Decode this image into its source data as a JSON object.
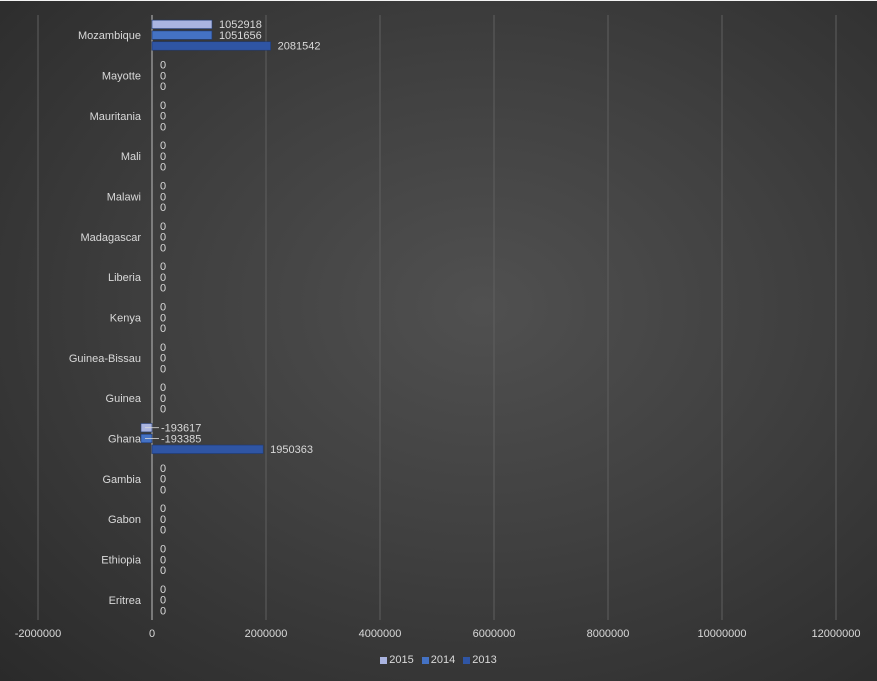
{
  "chart_data": {
    "type": "bar",
    "orientation": "horizontal",
    "title": "",
    "xlabel": "",
    "ylabel": "",
    "xlim": [
      -2000000,
      12000000
    ],
    "x_ticks": [
      -2000000,
      0,
      2000000,
      4000000,
      6000000,
      8000000,
      10000000,
      12000000
    ],
    "x_tick_labels": [
      "-2000000",
      "0",
      "2000000",
      "4000000",
      "6000000",
      "8000000",
      "10000000",
      "12000000"
    ],
    "grid": true,
    "legend_position": "bottom",
    "categories": [
      "Mozambique",
      "Mayotte",
      "Mauritania",
      "Mali",
      "Malawi",
      "Madagascar",
      "Liberia",
      "Kenya",
      "Guinea-Bissau",
      "Guinea",
      "Ghana",
      "Gambia",
      "Gabon",
      "Ethiopia",
      "Eritrea"
    ],
    "series": [
      {
        "name": "2015",
        "color": "#aab4e0",
        "values": [
          1052918,
          0,
          0,
          0,
          0,
          0,
          0,
          0,
          0,
          0,
          -193617,
          0,
          0,
          0,
          0
        ]
      },
      {
        "name": "2014",
        "color": "#4472c4",
        "values": [
          1051656,
          0,
          0,
          0,
          0,
          0,
          0,
          0,
          0,
          0,
          -193385,
          0,
          0,
          0,
          0
        ]
      },
      {
        "name": "2013",
        "color": "#2f55a4",
        "values": [
          2081542,
          0,
          0,
          0,
          0,
          0,
          0,
          0,
          0,
          0,
          1950363,
          0,
          0,
          0,
          0
        ]
      }
    ]
  },
  "legend": [
    {
      "label": "2015",
      "color": "#aab4e0"
    },
    {
      "label": "2014",
      "color": "#4472c4"
    },
    {
      "label": "2013",
      "color": "#2f55a4"
    }
  ]
}
